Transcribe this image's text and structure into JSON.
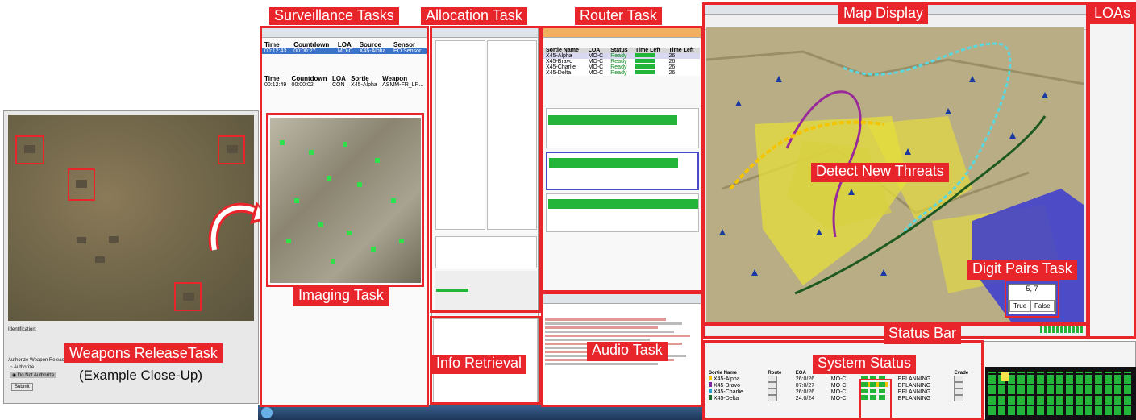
{
  "labels": {
    "surveillance": "Surveillance Tasks",
    "allocation": "Allocation Task",
    "router": "Router Task",
    "map_display": "Map Display",
    "loas": "LOAs",
    "detect_threats": "Detect New Threats",
    "digit_pairs": "Digit Pairs Task",
    "status_bar": "Status Bar",
    "system_status": "System Status",
    "imaging": "Imaging Task",
    "audio": "Audio Task",
    "info_retrieval": "Info Retrieval",
    "weapons_release": "Weapons ReleaseTask",
    "example_closeup": "(Example Close-Up)"
  },
  "imaging_tasks": {
    "columns": [
      "Time",
      "Countdown",
      "LOA",
      "Source",
      "Sensor"
    ],
    "row": [
      "00:12:43",
      "00:00:27",
      "MO-C",
      "X45-Alpha",
      "EO Sensor"
    ]
  },
  "weapon_release_tasks": {
    "columns": [
      "Time",
      "Countdown",
      "LOA",
      "Sortie",
      "Weapon"
    ],
    "row": [
      "00:12:49",
      "00:00:02",
      "CON",
      "X45-Alpha",
      "ASMM-FR_LR..."
    ]
  },
  "router": {
    "columns": [
      "Sortie Name",
      "LOA",
      "Status",
      "Time Left",
      "Time Left"
    ],
    "rows": [
      {
        "name": "X45-Alpha",
        "loa": "MO-C",
        "status": "Ready",
        "progress": 0.85,
        "time": "26"
      },
      {
        "name": "X45-Bravo",
        "loa": "MO-C",
        "status": "Ready",
        "progress": 0.85,
        "time": "26"
      },
      {
        "name": "X45-Charlie",
        "loa": "MO-C",
        "status": "Ready",
        "progress": 0.85,
        "time": "26"
      },
      {
        "name": "X45-Delta",
        "loa": "MO-C",
        "status": "Ready",
        "progress": 0.85,
        "time": "26"
      }
    ]
  },
  "digit_pairs": {
    "pair": "5, 7",
    "true_label": "True",
    "false_label": "False"
  },
  "system_status": {
    "columns": [
      "Sortie Name",
      "Route",
      "EOA",
      "LOA",
      "Evade"
    ],
    "rows": [
      {
        "name": "X45-Alpha",
        "eoa": "26:0/26",
        "loa": "MO-C",
        "state": "EPLANNING",
        "color": "#f5c400"
      },
      {
        "name": "X45-Bravo",
        "eoa": "07:0/27",
        "loa": "MO-C",
        "state": "EPLANNING",
        "color": "#7a2a9a"
      },
      {
        "name": "X45-Charlie",
        "eoa": "26:0/26",
        "loa": "MO-C",
        "state": "EPLANNING",
        "color": "#22a0d0"
      },
      {
        "name": "X45-Delta",
        "eoa": "24:0/24",
        "loa": "MO-C",
        "state": "EPLANNING",
        "color": "#1e6a2a"
      }
    ]
  },
  "weapons_release_closeup": {
    "identification": "Identification:",
    "question": "Authorize Weapon Release?",
    "opt_authorize": "Authorize",
    "opt_do_not": "Do Not Authorize",
    "submit": "Submit"
  },
  "colors": {
    "label_red": "#e8252b",
    "map_yellow": "#e6df3a",
    "threat_blue": "#3a3ad0"
  }
}
